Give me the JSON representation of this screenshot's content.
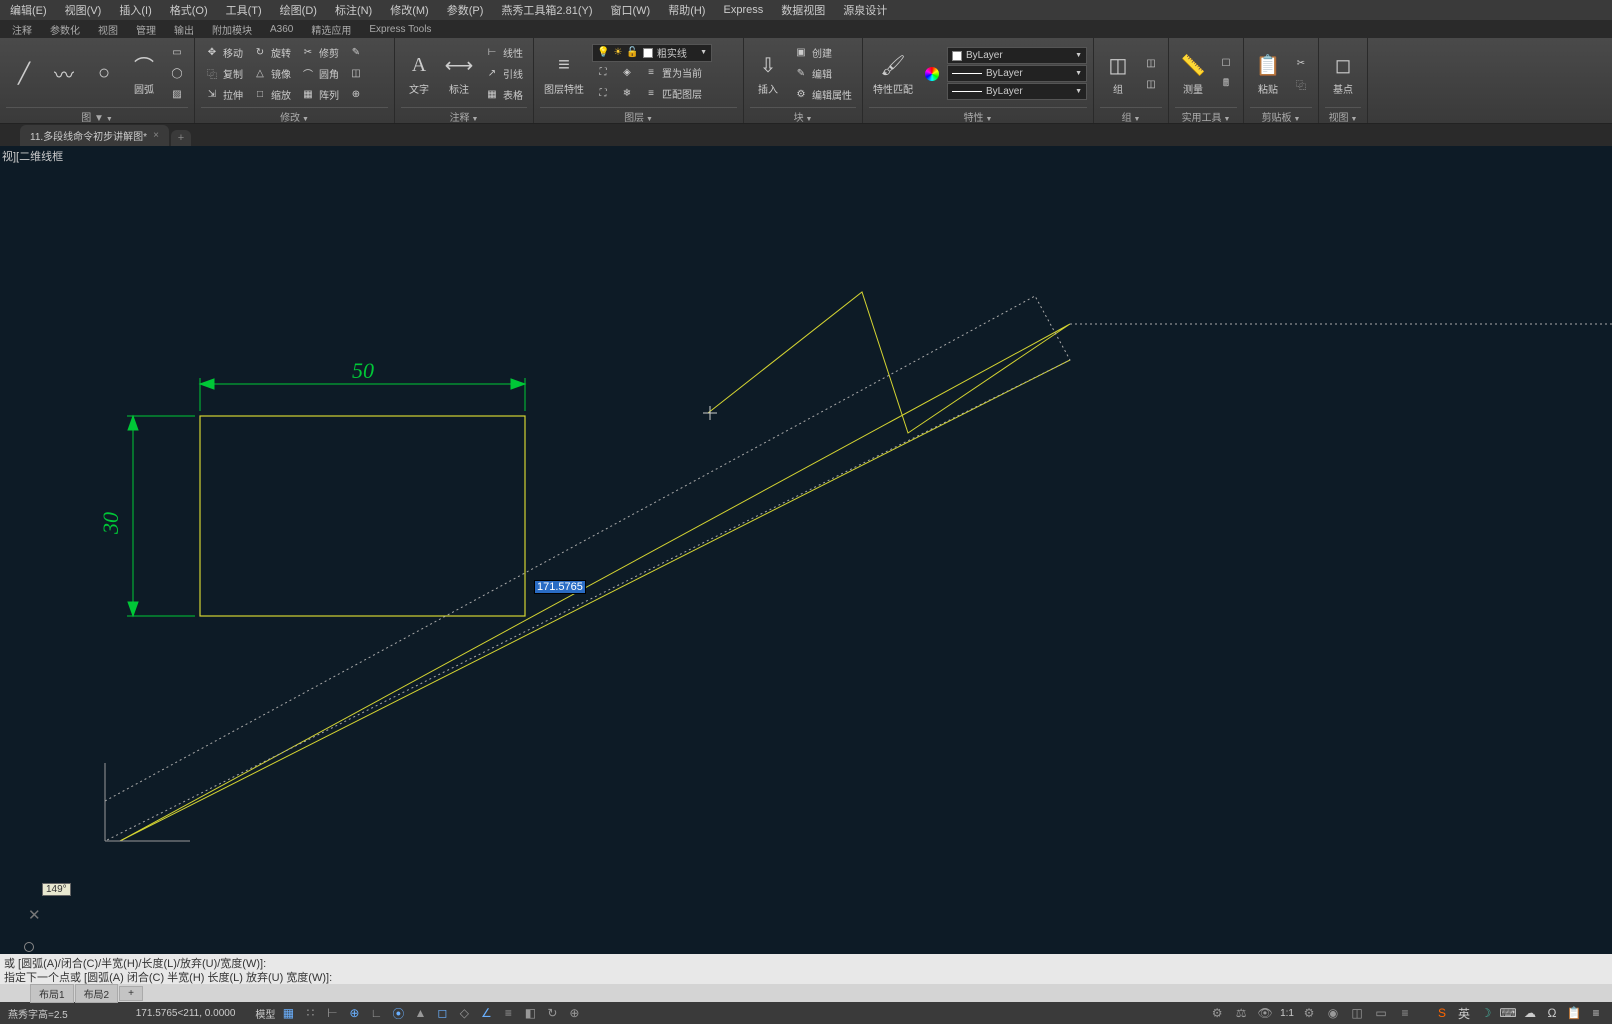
{
  "menubar": [
    "编辑(E)",
    "视图(V)",
    "插入(I)",
    "格式(O)",
    "工具(T)",
    "绘图(D)",
    "标注(N)",
    "修改(M)",
    "参数(P)",
    "燕秀工具箱2.81(Y)",
    "窗口(W)",
    "帮助(H)",
    "Express",
    "数据视图",
    "源泉设计"
  ],
  "secondary_tabs": [
    "注释",
    "参数化",
    "视图",
    "管理",
    "输出",
    "附加模块",
    "A360",
    "精选应用",
    "Express Tools"
  ],
  "ribbon": {
    "draw_panel": {
      "arc_label": "圆弧",
      "title": "图 ▼"
    },
    "modify_panel": {
      "title": "修改",
      "r1": [
        {
          "icon": "↔",
          "label": "移动"
        },
        {
          "icon": "↻",
          "label": "旋转"
        },
        {
          "icon": "✂",
          "label": "修剪"
        },
        {
          "icon": "✎",
          "label": ""
        }
      ],
      "r2": [
        {
          "icon": "⿻",
          "label": "复制"
        },
        {
          "icon": "△",
          "label": "镜像"
        },
        {
          "icon": "⌒",
          "label": "圆角"
        },
        {
          "icon": "◫",
          "label": ""
        }
      ],
      "r3": [
        {
          "icon": "⇲",
          "label": "拉伸"
        },
        {
          "icon": "□",
          "label": "缩放"
        },
        {
          "icon": "▦",
          "label": "阵列"
        },
        {
          "icon": "⊕",
          "label": ""
        }
      ]
    },
    "annotate_panel": {
      "title": "注释",
      "text_label": "文字",
      "dim_label": "标注",
      "r1": {
        "label": "线性"
      },
      "r2": {
        "label": "引线"
      },
      "r3": {
        "label": "表格"
      }
    },
    "layers_panel": {
      "title": "图层",
      "props_label": "图层特性",
      "current_layer": "粗实线",
      "match": "匹配图层",
      "set_current": "置为当前"
    },
    "block_panel": {
      "title": "块",
      "insert_label": "插入",
      "create": "创建",
      "edit": "编辑",
      "edit_attr": "编辑属性"
    },
    "props_panel": {
      "title": "特性",
      "match_label": "特性匹配",
      "layer": "ByLayer",
      "lineweight": "ByLayer",
      "linetype": "ByLayer"
    },
    "group_panel": {
      "title": "组",
      "label": "组"
    },
    "util_panel": {
      "title": "实用工具",
      "label": "测量"
    },
    "clip_panel": {
      "title": "剪贴板",
      "label": "粘贴"
    },
    "view_panel": {
      "title": "视图",
      "label": "基点"
    }
  },
  "file_tab": "11.多段线命令初步讲解图*",
  "view_label": "视][二维线框",
  "drawing": {
    "dim_h": "50",
    "dim_v": "30",
    "tooltip": "171.5765",
    "angle": "149°"
  },
  "command": {
    "line1": "或  [圆弧(A)/闭合(C)/半宽(H)/长度(L)/放弃(U)/宽度(W)]:",
    "line2": "指定下一个点或  [圆弧(A) 闭合(C) 半宽(H)  长度(L) 放弃(U) 宽度(W)]:"
  },
  "layout_tabs": [
    "布局1",
    "布局2"
  ],
  "status": {
    "yanxiu": "燕秀字高=2.5",
    "coords": "171.5765<211, 0.0000",
    "model": "模型",
    "scale": "1:1",
    "ime": "英"
  }
}
